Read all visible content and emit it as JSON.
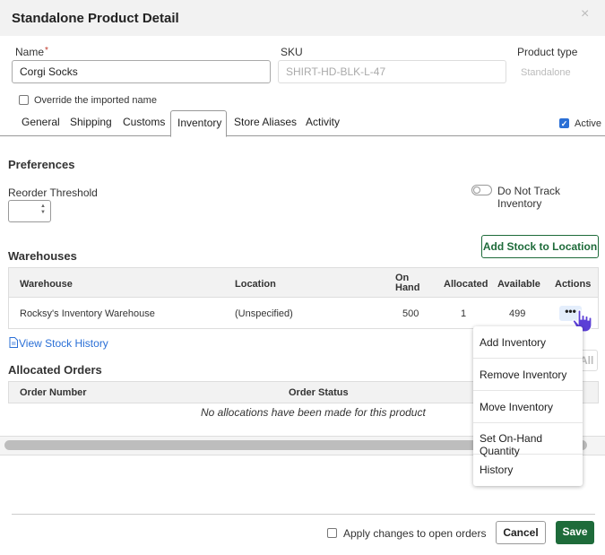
{
  "dialog": {
    "title": "Standalone Product Detail",
    "close_glyph": "×"
  },
  "form": {
    "name_label": "Name",
    "name_required": "*",
    "name_value": "Corgi Socks",
    "sku_label": "SKU",
    "sku_placeholder": "SHIRT-HD-BLK-L-47",
    "product_type_label": "Product type",
    "product_type_value": "Standalone",
    "override_label": "Override the imported name"
  },
  "tabs": {
    "general": "General",
    "shipping": "Shipping",
    "customs": "Customs",
    "inventory": "Inventory",
    "store_aliases": "Store Aliases",
    "activity": "Activity",
    "active_label": "Active",
    "active_checked": true
  },
  "preferences": {
    "title": "Preferences",
    "reorder_label": "Reorder Threshold",
    "do_not_track_label": "Do Not Track Inventory"
  },
  "warehouses": {
    "title": "Warehouses",
    "add_stock_button": "Add Stock to Location",
    "columns": {
      "warehouse": "Warehouse",
      "location": "Location",
      "on_hand_1": "On",
      "on_hand_2": "Hand",
      "allocated": "Allocated",
      "available": "Available",
      "actions": "Actions"
    },
    "row": {
      "warehouse": "Rocksy's Inventory Warehouse",
      "location": "(Unspecified)",
      "on_hand": "500",
      "allocated": "1",
      "available": "499",
      "actions_glyph": "•••"
    },
    "view_history_link": "View Stock History"
  },
  "actions_menu": {
    "items": [
      "Add Inventory",
      "Remove Inventory",
      "Move Inventory",
      "Set On-Hand Quantity",
      "History"
    ]
  },
  "allocated_orders": {
    "title": "Allocated Orders",
    "partial_button": "All",
    "columns": {
      "order_number": "Order Number",
      "order_status": "Order Status"
    },
    "empty_message": "No allocations have been made for this product"
  },
  "footer": {
    "apply_label": "Apply changes to open orders",
    "cancel_button": "Cancel",
    "save_button": "Save"
  },
  "colors": {
    "accent_green": "#1e6b3a",
    "link_blue": "#2a6fd6",
    "cursor_purple": "#5b3fd6"
  }
}
